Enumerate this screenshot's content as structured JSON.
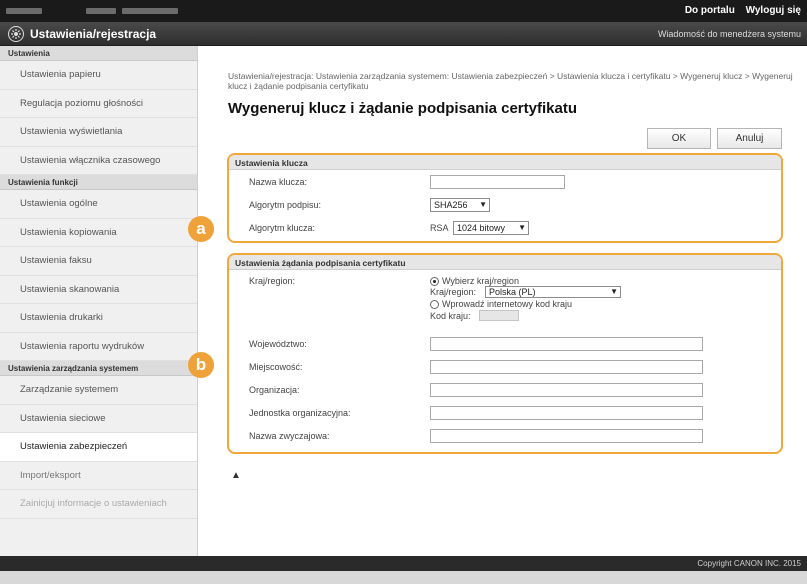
{
  "topbar": {
    "logout_links": [
      "Do portalu",
      "Wyloguj się"
    ]
  },
  "header": {
    "title": "Ustawienia/rejestracja",
    "message_link": "Wiadomość do menedżera systemu"
  },
  "sidebar": {
    "sections": [
      {
        "title": "Ustawienia",
        "items": [
          "Ustawienia papieru",
          "Regulacja poziomu głośności",
          "Ustawienia wyświetlania",
          "Ustawienia włącznika czasowego"
        ]
      },
      {
        "title": "Ustawienia funkcji",
        "items": [
          "Ustawienia ogólne",
          "Ustawienia kopiowania",
          "Ustawienia faksu",
          "Ustawienia skanowania",
          "Ustawienia drukarki",
          "Ustawienia raportu wydruków"
        ]
      },
      {
        "title": "Ustawienia zarządzania systemem",
        "items": [
          "Zarządzanie systemem",
          "Ustawienia sieciowe",
          "Ustawienia zabezpieczeń",
          "Import/eksport",
          "Zainicjuj informacje o ustawieniach"
        ]
      }
    ]
  },
  "main": {
    "breadcrumb": "Ustawienia/rejestracja: Ustawienia zarządzania systemem: Ustawienia zabezpieczeń > Ustawienia klucza i certyfikatu > Wygeneruj klucz > Wygeneruj klucz i żądanie podpisania certyfikatu",
    "page_title": "Wygeneruj klucz i żądanie podpisania certyfikatu",
    "ok_label": "OK",
    "cancel_label": "Anuluj",
    "key_settings": {
      "heading": "Ustawienia klucza",
      "key_name_label": "Nazwa klucza:",
      "key_name_value": "",
      "sig_alg_label": "Algorytm podpisu:",
      "sig_alg_value": "SHA256",
      "key_alg_label": "Algorytm klucza:",
      "key_alg_prefix": "RSA",
      "key_alg_value": "1024 bitowy"
    },
    "csr_settings": {
      "heading": "Ustawienia żądania podpisania certyfikatu",
      "country_label": "Kraj/region:",
      "option_select": "Wybierz kraj/region",
      "country_inner_label": "Kraj/region:",
      "country_value": "Polska (PL)",
      "option_enter": "Wprowadź internetowy kod kraju",
      "country_code_label": "Kod kraju:",
      "fields": [
        "Województwo:",
        "Miejscowość:",
        "Organizacja:",
        "Jednostka organizacyjna:",
        "Nazwa zwyczajowa:"
      ]
    },
    "top_link": "▲"
  },
  "annotations": {
    "badge_a": "a",
    "badge_b": "b"
  },
  "footer": {
    "copyright": "Copyright CANON INC. 2015"
  },
  "colors": {
    "accent": "#f2a73b",
    "badge": "#f0a23a",
    "topbar": "#1a1a1a"
  }
}
